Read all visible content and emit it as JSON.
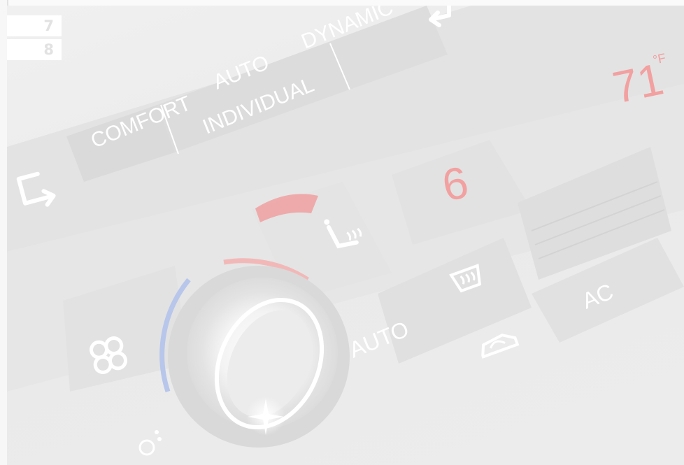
{
  "page_tabs": [
    "7",
    "8"
  ],
  "panel": {
    "mode_buttons": {
      "comfort": "COMFORT",
      "auto": "AUTO",
      "individual": "INDIVIDUAL",
      "dynamic": "DYNAMIC"
    },
    "fan_display": "6",
    "temperature": {
      "value": "71",
      "unit": "°F"
    },
    "auto_button": "AUTO",
    "ac_button": "AC",
    "icons": [
      "back-arrow-icon",
      "return-arrow-icon",
      "fan-icon",
      "seat-heat-icon",
      "rear-defrost-icon",
      "recirculation-icon",
      "footwell-icon"
    ],
    "colors": {
      "display_red": "#f2a0a0",
      "heat_indicator": "#f0a0a0",
      "cool_arc": "#b7c6ea",
      "warm_arc": "#f2b8b8"
    }
  }
}
